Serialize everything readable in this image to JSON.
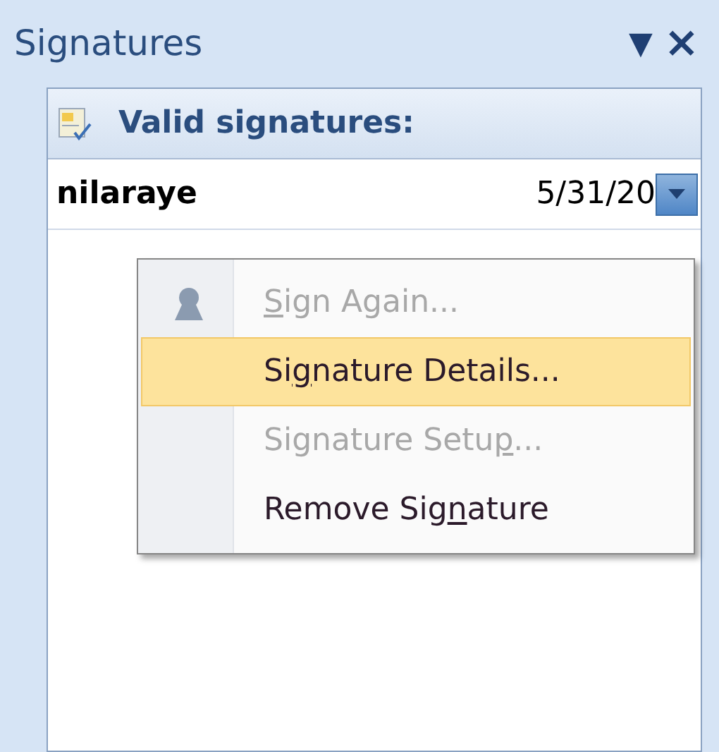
{
  "pane": {
    "title": "Signatures",
    "dropdown_glyph": "▼",
    "close_glyph": "×"
  },
  "section": {
    "heading": "Valid signatures:"
  },
  "signatures": [
    {
      "signer": "nilaraye",
      "date": "5/31/20",
      "selected": true
    }
  ],
  "context_menu": [
    {
      "access_key": "S",
      "after": "ign Again...",
      "disabled": true,
      "selected": false,
      "has_icon": true
    },
    {
      "before": "Si",
      "access_key": "g",
      "after": "nature Details...",
      "disabled": false,
      "selected": true,
      "has_icon": false
    },
    {
      "before": "Signature Setu",
      "access_key": "p",
      "after": "...",
      "disabled": true,
      "selected": false,
      "has_icon": false
    },
    {
      "before": "Remove Sig",
      "access_key": "n",
      "after": "ature",
      "disabled": false,
      "selected": false,
      "has_icon": false
    }
  ]
}
